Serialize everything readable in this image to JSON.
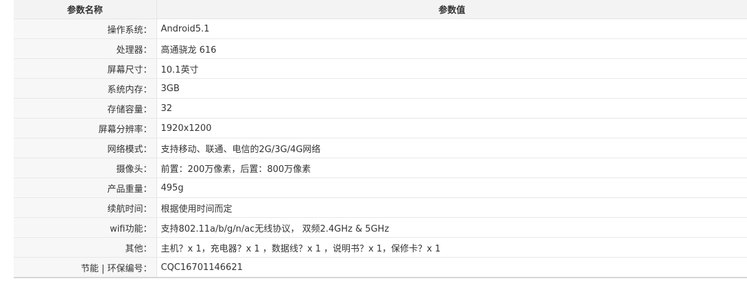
{
  "table": {
    "header": {
      "name": "参数名称",
      "value": "参数值"
    },
    "rows": [
      {
        "name": "操作系统：",
        "value": "Android5.1"
      },
      {
        "name": "处理器：",
        "value": "高通骁龙 616"
      },
      {
        "name": "屏幕尺寸：",
        "value": "10.1英寸"
      },
      {
        "name": "系统内存：",
        "value": "3GB"
      },
      {
        "name": "存储容量：",
        "value": "32"
      },
      {
        "name": "屏幕分辨率：",
        "value": "1920x1200"
      },
      {
        "name": "网络模式：",
        "value": "支持移动、联通、电信的2G/3G/4G网络"
      },
      {
        "name": "摄像头：",
        "value": "前置：200万像素，后置：800万像素"
      },
      {
        "name": "产品重量：",
        "value": "495g"
      },
      {
        "name": "续航时间：",
        "value": "根据使用时间而定"
      },
      {
        "name": "wifi功能：",
        "value": "支持802.11a/b/g/n/ac无线协议， 双频2.4GHz & 5GHz"
      },
      {
        "name": "其他：",
        "value": "主机？x 1，充电器？x 1 ，数据线？x 1 ，说明书？x 1，保修卡？x 1"
      },
      {
        "name": "节能 | 环保编号：",
        "value": "CQC16701146621"
      }
    ]
  }
}
